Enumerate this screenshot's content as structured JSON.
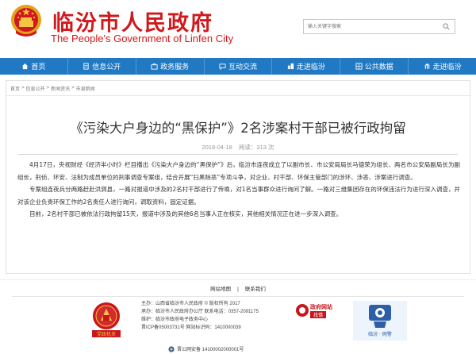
{
  "header": {
    "title": "临汾市人民政府",
    "subtitle": "The People's Government of Linfen City",
    "search_placeholder": "输入关键字搜索"
  },
  "nav": {
    "items": [
      {
        "label": "首页",
        "icon": "home-icon"
      },
      {
        "label": "信息公开",
        "icon": "document-icon"
      },
      {
        "label": "政务服务",
        "icon": "briefcase-icon"
      },
      {
        "label": "互动交流",
        "icon": "chat-icon"
      },
      {
        "label": "走进临汾",
        "icon": "city-icon"
      },
      {
        "label": "公共数据",
        "icon": "database-icon"
      },
      {
        "label": "走进临汾",
        "icon": "building-icon"
      }
    ]
  },
  "breadcrumb": [
    "首页",
    "信息公开",
    "新闻资讯",
    "市县新闻"
  ],
  "article": {
    "title": "《污染大户身边的“黑保护”》2名涉案村干部已被行政拘留",
    "date": "2018-04-18",
    "views_label": "阅读：313 次",
    "paragraphs": [
      "4月17日，央视财经《经济半小时》栏目播出《污染大户身边的“黑保护”》后，临汾市连夜成立了以副市长、市公安局局长马德荣为组长、两名市公安局副局长为副组长，刑侦、环安、法制为成员单位的刑事调查专案组，结合开展“扫黑除恶”专项斗争，对企业、村干部、环保主管部门的涉环、涉恶、涉案进行调查。",
      "专案组连夜兵分两路赶赴洪洞县，一路对报道中涉及的2名村干部进行了传唤，对1名当事群众进行询问了解。一路对三维集团存在的环保违法行为进行深入调查，并对该企业负责环保工作的2名责任人进行询问，调取资料，固定证据。",
      "目前，2名村干部已被依法行政拘留15天，报道中涉及的其他6名当事人正在核实，其他相关情况正在进一步深入调查。"
    ]
  },
  "footer": {
    "links": [
      "网站地图",
      "联系我们"
    ],
    "info": [
      "主办：山西省临汾市人民政府  © 版权所有 2017",
      "承办：临汾市人民政府办公厅  联系电话：0357-2091175",
      "维护：临汾市政府电子政务中心",
      "晋ICP备05003731号  网站标识码：1410000039"
    ],
    "beian": "晋公网安备 14100002000001号",
    "badge_left_label": "党政机关",
    "badge_right_label": "政府网站",
    "badge_right_sub": "找错",
    "badge_right2_label": "临汾 · 网警"
  },
  "colors": {
    "brand_red": "#d0191c",
    "nav_blue": "#2179c3"
  }
}
